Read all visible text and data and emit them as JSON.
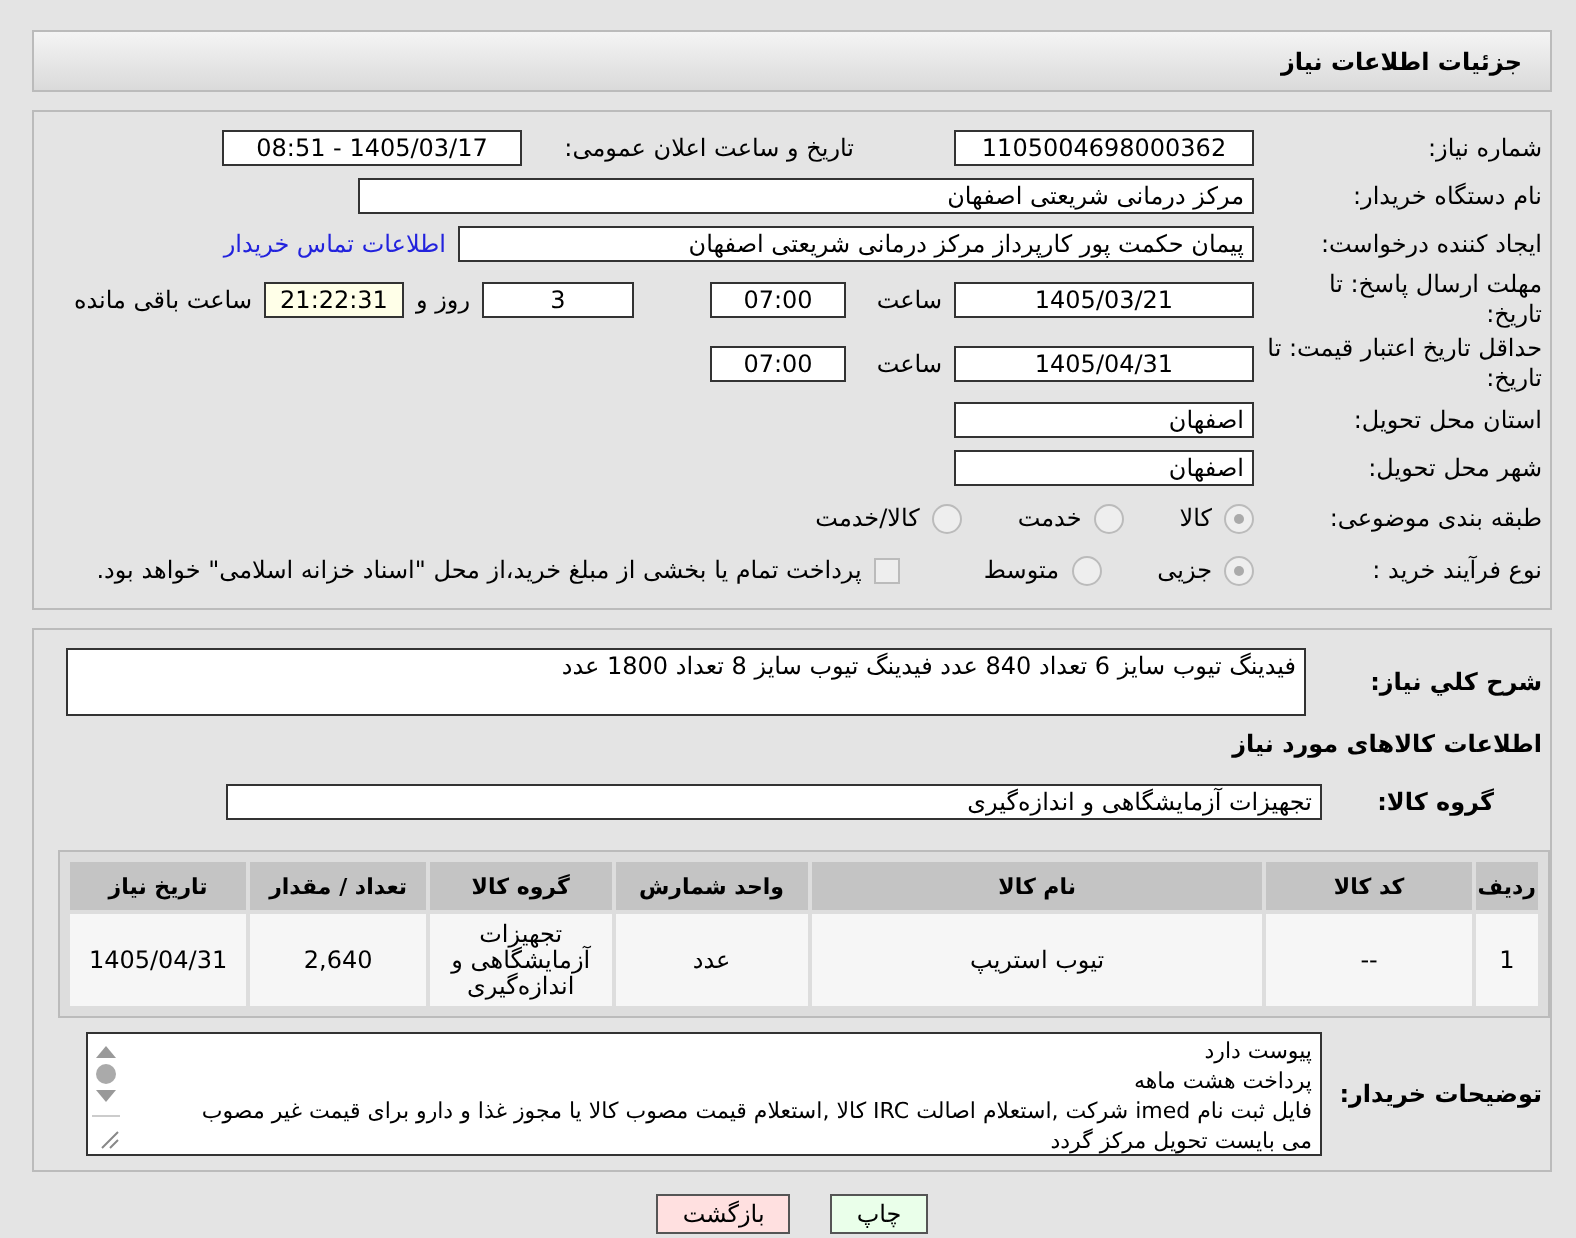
{
  "title": "جزئیات اطلاعات نیاز",
  "need_number": {
    "label": "شماره نیاز:",
    "value": "1105004698000362"
  },
  "announce": {
    "label": "تاریخ و ساعت اعلان عمومی:",
    "value": "1405/03/17 - 08:51"
  },
  "buyer_org": {
    "label": "نام دستگاه خریدار:",
    "value": "مرکز درمانی شریعتی اصفهان"
  },
  "creator": {
    "label": "ایجاد کننده درخواست:",
    "value": "پیمان حکمت پور کارپرداز مرکز درمانی شریعتی اصفهان",
    "link": "اطلاعات تماس خریدار"
  },
  "deadline": {
    "label": "مهلت ارسال پاسخ: تا تاریخ:",
    "date": "1405/03/21",
    "time_label": "ساعت",
    "time": "07:00",
    "days": "3",
    "days_label": "روز و",
    "remaining": "21:22:31",
    "remaining_label": "ساعت باقی مانده"
  },
  "validity": {
    "label": "حداقل تاریخ اعتبار قیمت: تا تاریخ:",
    "date": "1405/04/31",
    "time_label": "ساعت",
    "time": "07:00"
  },
  "province": {
    "label": "استان محل تحویل:",
    "value": "اصفهان"
  },
  "city": {
    "label": "شهر محل تحویل:",
    "value": "اصفهان"
  },
  "category": {
    "label": "طبقه بندی موضوعی:",
    "options": [
      {
        "label": "کالا",
        "selected": true
      },
      {
        "label": "خدمت",
        "selected": false
      },
      {
        "label": "کالا/خدمت",
        "selected": false
      }
    ]
  },
  "purchase_type": {
    "label": "نوع فرآیند خرید :",
    "options": [
      {
        "label": "جزیی",
        "selected": true
      },
      {
        "label": "متوسط",
        "selected": false
      }
    ],
    "treasury": {
      "label": "پرداخت تمام یا بخشی از مبلغ خرید،از محل \"اسناد خزانه اسلامی\" خواهد بود.",
      "checked": false
    }
  },
  "description": {
    "label": "شرح کلي نياز:",
    "value": "فیدینگ تیوب سایز 6 تعداد  840 عدد فیدینگ تیوب سایز 8 تعداد 1800 عدد"
  },
  "goods_heading": "اطلاعات کالاهای مورد نیاز",
  "goods_group": {
    "label": "گروه کالا:",
    "value": "تجهیزات آزمایشگاهی و اندازه‌گیری"
  },
  "table": {
    "columns": [
      "ردیف",
      "کد کالا",
      "نام کالا",
      "واحد شمارش",
      "گروه کالا",
      "تعداد / مقدار",
      "تاریخ نیاز"
    ],
    "rows": [
      [
        "1",
        "--",
        "تیوب استریپ",
        "عدد",
        "تجهیزات آزمایشگاهی و اندازه‌گیری",
        "2,640",
        "1405/04/31"
      ]
    ]
  },
  "notes": {
    "label": "توضیحات خریدار:",
    "lines": [
      "پیوست دارد",
      "پرداخت هشت ماهه",
      "فایل ثبت نام imed شرکت ,استعلام اصالت IRC کالا ,استعلام قیمت مصوب کالا یا مجوز غذا و دارو برای قیمت غیر مصوب",
      "می بایست تحویل مرکز گردد"
    ]
  },
  "buttons": [
    {
      "kind": "print",
      "label": "چاپ"
    },
    {
      "kind": "back",
      "label": "بازگشت"
    }
  ]
}
